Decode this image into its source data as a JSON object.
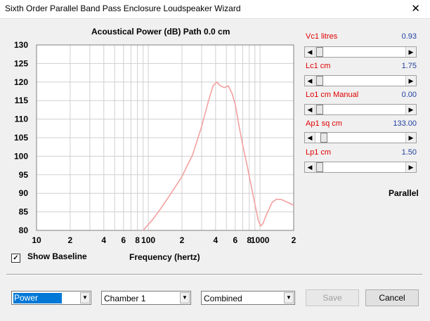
{
  "window": {
    "title": "Sixth Order Parallel Band Pass Enclosure Loudspeaker Wizard",
    "close_glyph": "✕"
  },
  "chart_title": "Acoustical Power (dB)   Path 0.0 cm",
  "chart_data": {
    "type": "line",
    "title": "Acoustical Power (dB)   Path 0.0 cm",
    "xlabel": "Frequency (hertz)",
    "ylabel": "",
    "xscale": "log",
    "xlim": [
      10,
      2000
    ],
    "ylim": [
      80,
      130
    ],
    "y_ticks": [
      80,
      85,
      90,
      95,
      100,
      105,
      110,
      115,
      120,
      125,
      130
    ],
    "x_tick_labels": [
      {
        "v": 10,
        "t": "10"
      },
      {
        "v": 20,
        "t": "2"
      },
      {
        "v": 40,
        "t": "4"
      },
      {
        "v": 60,
        "t": "6"
      },
      {
        "v": 80,
        "t": "8"
      },
      {
        "v": 100,
        "t": "100"
      },
      {
        "v": 200,
        "t": "2"
      },
      {
        "v": 400,
        "t": "4"
      },
      {
        "v": 600,
        "t": "6"
      },
      {
        "v": 800,
        "t": "8"
      },
      {
        "v": 1000,
        "t": "1000"
      },
      {
        "v": 2000,
        "t": "2"
      }
    ],
    "grid": true,
    "series": [
      {
        "color": "#f4a0a0",
        "x": [
          90,
          110,
          130,
          160,
          200,
          250,
          300,
          350,
          380,
          410,
          440,
          480,
          520,
          560,
          600,
          650,
          700,
          760,
          820,
          880,
          930,
          970,
          1010,
          1060,
          1150,
          1280,
          1400,
          1560,
          1750,
          2000
        ],
        "y": [
          80.0,
          83.0,
          86.0,
          90.0,
          94.5,
          100.5,
          108.0,
          115.5,
          119.0,
          120.0,
          119.0,
          118.5,
          119.0,
          117.0,
          114.0,
          108.0,
          103.0,
          98.0,
          93.0,
          88.5,
          85.0,
          82.5,
          81.2,
          81.8,
          84.5,
          87.5,
          88.4,
          88.3,
          87.6,
          86.8
        ]
      }
    ]
  },
  "params": [
    {
      "label": "Vc1  litres",
      "value": "0.93",
      "pos": 0.02
    },
    {
      "label": "Lc1  cm",
      "value": "1.75",
      "pos": 0.02
    },
    {
      "label": "Lo1  cm  Manual",
      "value": "0.00",
      "pos": 0.02
    },
    {
      "label": "Ap1  sq cm",
      "value": "133.00",
      "pos": 0.07
    },
    {
      "label": "Lp1  cm",
      "value": "1.50",
      "pos": 0.02
    }
  ],
  "mode_label": "Parallel",
  "baseline": {
    "checked_glyph": "✓",
    "label": "Show Baseline"
  },
  "freq_label": "Frequency (hertz)",
  "combos": [
    {
      "value": "Power"
    },
    {
      "value": "Chamber 1"
    },
    {
      "value": "Combined"
    }
  ],
  "buttons": {
    "save": "Save",
    "cancel": "Cancel"
  },
  "arrows": {
    "left": "◀",
    "right": "▶",
    "down": "▼"
  },
  "colors": {
    "curve": "#f4a0a0",
    "param_label": "#e00000",
    "param_value": "#1f3f9f",
    "selection": "#0078d7"
  }
}
